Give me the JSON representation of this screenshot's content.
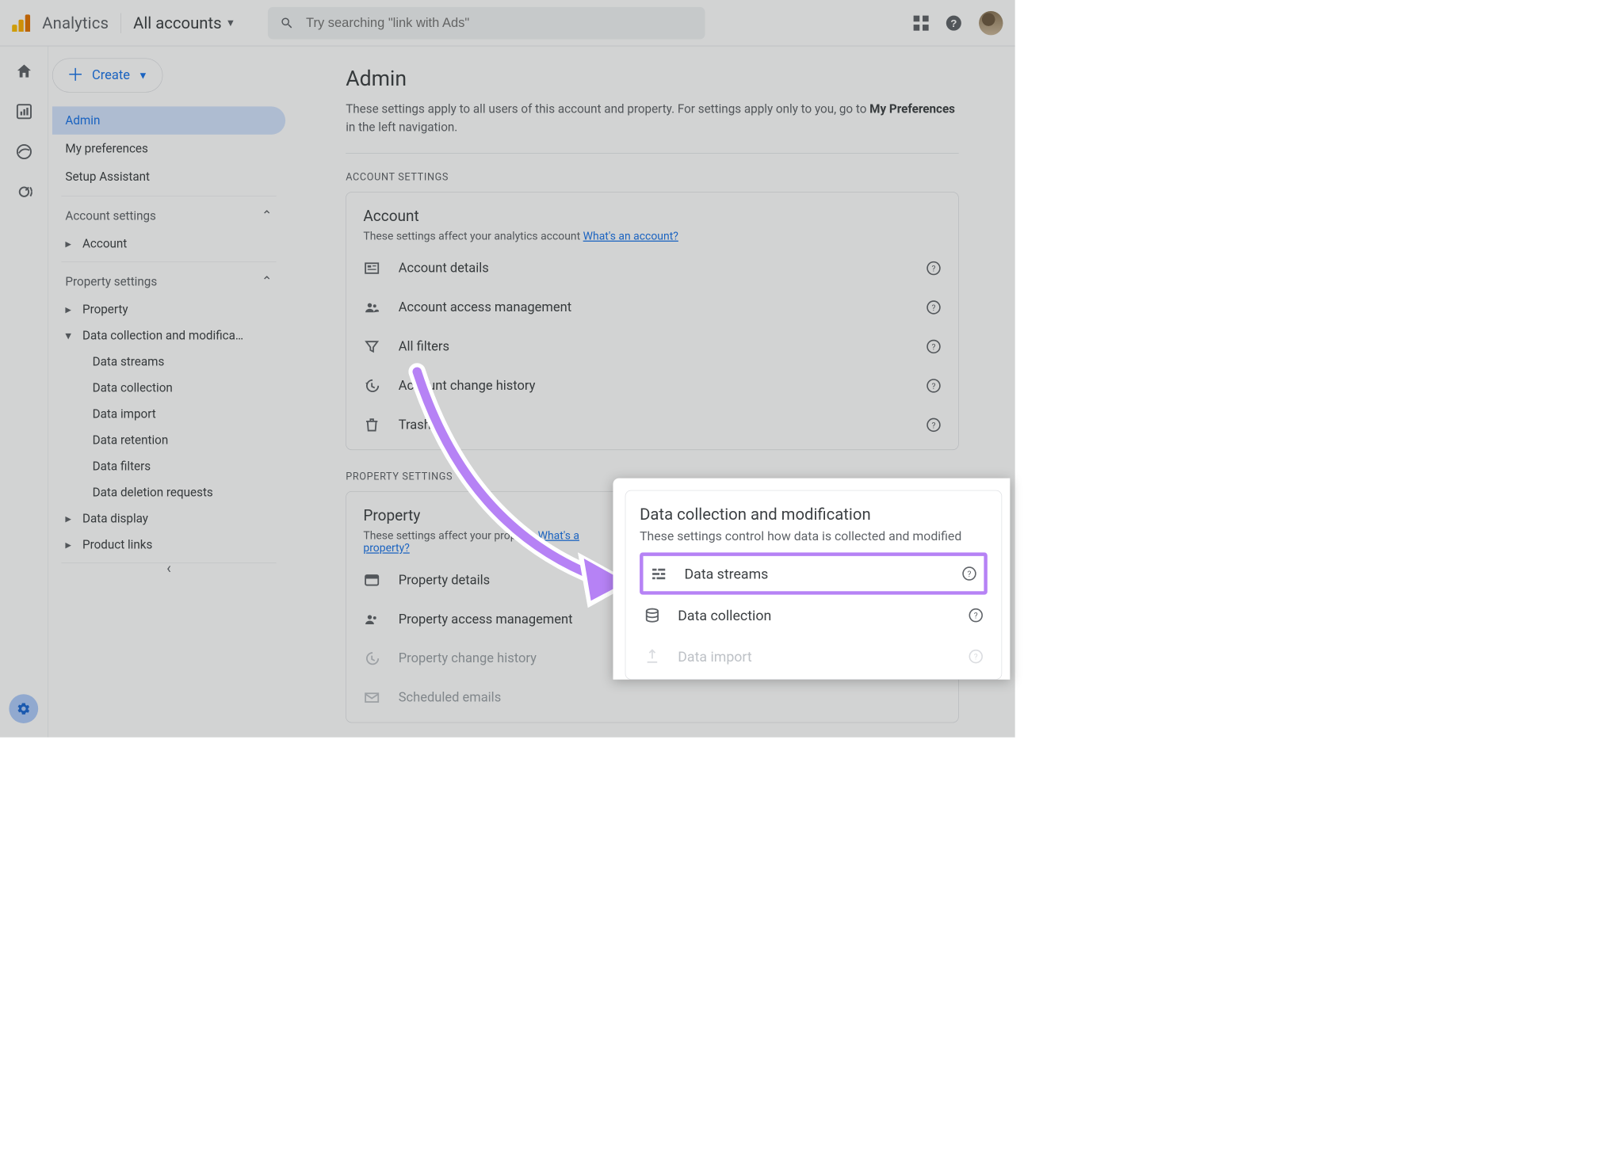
{
  "header": {
    "app_title": "Analytics",
    "accounts_label": "All accounts",
    "search_placeholder": "Try searching \"link with Ads\""
  },
  "create_button": {
    "label": "Create"
  },
  "sidebar": {
    "items": [
      {
        "label": "Admin",
        "active": true
      },
      {
        "label": "My preferences"
      },
      {
        "label": "Setup Assistant"
      }
    ],
    "group_account": {
      "label": "Account settings"
    },
    "account_item": {
      "label": "Account"
    },
    "group_property": {
      "label": "Property settings"
    },
    "property_item": {
      "label": "Property"
    },
    "dcm_item": {
      "label": "Data collection and modifica…"
    },
    "dcm_children": [
      {
        "label": "Data streams"
      },
      {
        "label": "Data collection"
      },
      {
        "label": "Data import"
      },
      {
        "label": "Data retention"
      },
      {
        "label": "Data filters"
      },
      {
        "label": "Data deletion requests"
      }
    ],
    "data_display": {
      "label": "Data display"
    },
    "product_links": {
      "label": "Product links"
    }
  },
  "main": {
    "title": "Admin",
    "desc_part1": "These settings apply to all users of this account and property. For settings apply only to you, go to ",
    "desc_bold": "My Preferences",
    "desc_part2": " in the left navigation.",
    "section_account_label": "ACCOUNT SETTINGS",
    "account_card": {
      "title": "Account",
      "sub_text": "These settings affect your analytics account ",
      "sub_link": "What's an account?",
      "rows": [
        {
          "label": "Account details"
        },
        {
          "label": "Account access management"
        },
        {
          "label": "All filters"
        },
        {
          "label": "Account change history"
        },
        {
          "label": "Trash"
        }
      ]
    },
    "section_property_label": "PROPERTY SETTINGS",
    "property_card": {
      "title": "Property",
      "sub_text": "These settings affect your property ",
      "sub_link_1": "What's a",
      "sub_link_2": "property?",
      "rows": [
        {
          "label": "Property details"
        },
        {
          "label": "Property access management"
        },
        {
          "label": "Property change history",
          "muted": true
        },
        {
          "label": "Scheduled emails",
          "muted": true
        }
      ]
    }
  },
  "overlay": {
    "title": "Data collection and modification",
    "subtitle": "These settings control how data is collected and modified",
    "rows": [
      {
        "label": "Data streams",
        "highlight": true
      },
      {
        "label": "Data collection"
      },
      {
        "label": "Data import",
        "dim": true
      }
    ]
  }
}
